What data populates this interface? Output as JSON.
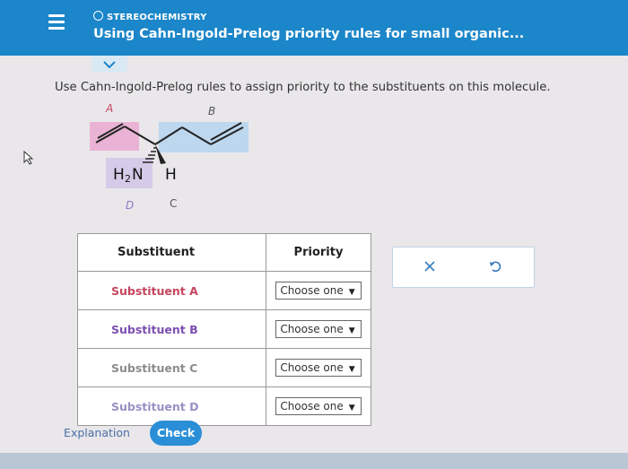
{
  "header": {
    "topic": "STEREOCHEMISTRY",
    "title": "Using Cahn-Ingold-Prelog priority rules for small organic..."
  },
  "instructions": "Use Cahn-Ingold-Prelog rules to assign priority to the substituents on this molecule.",
  "molecule": {
    "labels": {
      "a": "A",
      "b": "B",
      "c": "C",
      "d": "D"
    },
    "atoms": {
      "amine_h": "H",
      "amine_sub": "2",
      "amine_n": "N",
      "h": "H"
    }
  },
  "table": {
    "headers": {
      "substituent": "Substituent",
      "priority": "Priority"
    },
    "rows": [
      {
        "substituent": "Substituent A",
        "priority": "Choose one"
      },
      {
        "substituent": "Substituent B",
        "priority": "Choose one"
      },
      {
        "substituent": "Substituent C",
        "priority": "Choose one"
      },
      {
        "substituent": "Substituent D",
        "priority": "Choose one"
      }
    ]
  },
  "actions": {
    "x_icon": "close-icon",
    "undo_icon": "undo-icon"
  },
  "buttons": {
    "explanation": "Explanation",
    "check": "Check"
  }
}
